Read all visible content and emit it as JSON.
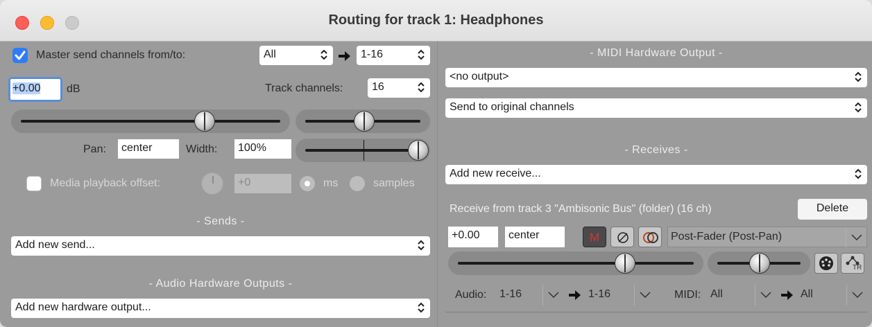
{
  "window": {
    "title": "Routing for track 1: Headphones"
  },
  "master_send": {
    "checkbox_checked": true,
    "label": "Master send channels from/to:",
    "from_value": "All",
    "to_value": "1-16",
    "volume_value": "+0.00",
    "volume_unit": "dB",
    "track_channels_label": "Track channels:",
    "track_channels_value": "16",
    "pan_label": "Pan:",
    "pan_value": "center",
    "width_label": "Width:",
    "width_value": "100%"
  },
  "media_offset": {
    "label": "Media playback offset:",
    "value": "+0",
    "unit_ms": "ms",
    "unit_samples": "samples"
  },
  "sends": {
    "heading": "- Sends -",
    "add_value": "Add new send..."
  },
  "hw_outputs": {
    "heading": "- Audio Hardware Outputs -",
    "add_value": "Add new hardware output..."
  },
  "midi_out": {
    "heading": "- MIDI Hardware Output -",
    "device_value": "<no output>",
    "channel_value": "Send to original channels"
  },
  "receives": {
    "heading": "- Receives -",
    "add_value": "Add new receive...",
    "item": {
      "title": "Receive from track 3 \"Ambisonic Bus\" (folder) (16 ch)",
      "delete_label": "Delete",
      "volume_value": "+0.00",
      "pan_value": "center",
      "mute_label": "M",
      "mode_value": "Post-Fader (Post-Pan)",
      "audio_label": "Audio:",
      "audio_from": "1-16",
      "audio_to": "1-16",
      "midi_label": "MIDI:",
      "midi_from": "All",
      "midi_to": "All",
      "tr_label": "TR"
    }
  },
  "colors": {
    "accent": "#2f7cf6",
    "mute_red": "#e03030",
    "background": "#9b9b9b"
  }
}
